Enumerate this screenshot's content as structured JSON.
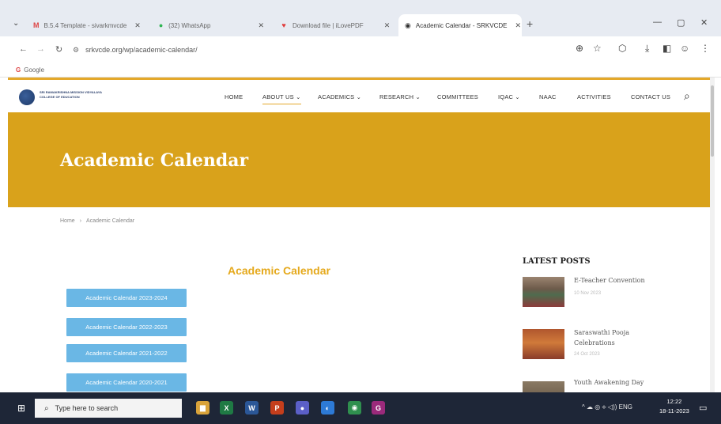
{
  "browser": {
    "tabs": [
      {
        "label": "B.5.4 Template - sivarkmvcde",
        "favicon": "M"
      },
      {
        "label": "(32) WhatsApp",
        "favicon": "●"
      },
      {
        "label": "Download file | iLovePDF",
        "favicon": "♥"
      },
      {
        "label": "Academic Calendar - SRKVCDE",
        "favicon": "◉"
      }
    ],
    "new_tab": "+",
    "url": "srkvcde.org/wp/academic-calendar/",
    "bookmark": "Google",
    "bookmark_icon": "G",
    "controls": {
      "minimize": "—",
      "maximize": "▢",
      "close": "✕"
    }
  },
  "site": {
    "college_name_line1": "SRI RAMAKRISHNA MISSION VIDYALAYA",
    "college_name_line2": "COLLEGE OF EDUCATION",
    "nav": [
      {
        "label": "HOME"
      },
      {
        "label": "ABOUT US ⌄"
      },
      {
        "label": "ACADEMICS ⌄"
      },
      {
        "label": "RESEARCH ⌄"
      },
      {
        "label": "COMMITTEES"
      },
      {
        "label": "IQAC ⌄"
      },
      {
        "label": "NAAC"
      },
      {
        "label": "ACTIVITIES"
      },
      {
        "label": "CONTACT US"
      }
    ],
    "search_icon": "⌕"
  },
  "banner": {
    "title": "Academic Calendar"
  },
  "breadcrumb": {
    "home": "Home",
    "sep": "›",
    "current": "Academic Calendar"
  },
  "content": {
    "title": "Academic Calendar",
    "buttons": [
      "Academic Calendar 2023-2024",
      "Academic Calendar 2022-2023",
      "Academic Calendar 2021-2022",
      "Academic Calendar 2020-2021"
    ]
  },
  "sidebar": {
    "title": "LATEST POSTS",
    "posts": [
      {
        "title": "E-Teacher Convention",
        "date": "10 Nov 2023"
      },
      {
        "title": "Saraswathi Pooja Celebrations",
        "date": "24 Oct 2023"
      },
      {
        "title": "Youth Awakening Day",
        "date": ""
      }
    ]
  },
  "taskbar": {
    "search_placeholder": "Type here to search",
    "apps": [
      {
        "name": "file-explorer",
        "glyph": "▆",
        "color": "#d9a33a"
      },
      {
        "name": "excel",
        "glyph": "X",
        "color": "#1f7a44"
      },
      {
        "name": "word",
        "glyph": "W",
        "color": "#2b5797"
      },
      {
        "name": "powerpoint",
        "glyph": "P",
        "color": "#c43e1c"
      },
      {
        "name": "teams",
        "glyph": "●",
        "color": "#5b5fc7"
      },
      {
        "name": "edge",
        "glyph": "◐",
        "color": "#2d7ad6"
      },
      {
        "name": "chrome",
        "glyph": "◉",
        "color": "#2f8f4e"
      },
      {
        "name": "app-g",
        "glyph": "G",
        "color": "#9b2a7b"
      }
    ],
    "tray": "^ ☁ ◎ ⟡ ◁)) ENG",
    "time": "12:22",
    "date": "18-11-2023"
  }
}
